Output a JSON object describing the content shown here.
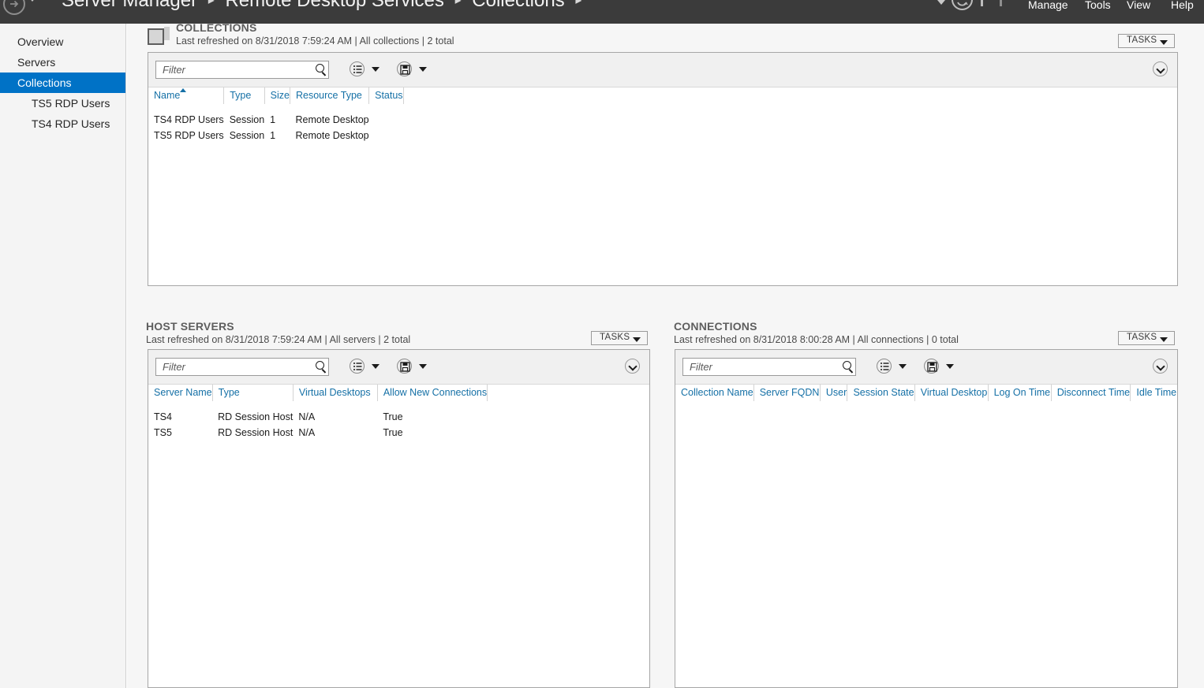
{
  "header": {
    "back_icon": "back-arrow-icon",
    "caret_icon": "chevron-down-icon",
    "breadcrumb": [
      "Server Manager",
      "Remote Desktop Services",
      "Collections"
    ],
    "separator": "▸",
    "refresh_icon": "refresh-icon",
    "notifications_icon": "flag-icon",
    "menus": [
      "Manage",
      "Tools",
      "View",
      "Help"
    ]
  },
  "sidebar": {
    "items": [
      {
        "label": "Overview",
        "selected": false,
        "sub": false
      },
      {
        "label": "Servers",
        "selected": false,
        "sub": false
      },
      {
        "label": "Collections",
        "selected": true,
        "sub": false
      },
      {
        "label": "TS5 RDP Users",
        "selected": false,
        "sub": true
      },
      {
        "label": "TS4 RDP Users",
        "selected": false,
        "sub": true
      }
    ],
    "selected_color": "#0072c6"
  },
  "collections_panel": {
    "icon": "monitor-icon",
    "title": "COLLECTIONS",
    "subtitle": "Last refreshed on 8/31/2018 7:59:24 AM | All collections  | 2 total",
    "tasks_label": "TASKS",
    "filter_placeholder": "Filter",
    "filter_value": "",
    "search_icon": "search-icon",
    "list-view_icon": "list-options-icon",
    "save_icon": "save-icon",
    "collapse_icon": "chevron-down-circle-icon",
    "columns": [
      "Name",
      "Type",
      "Size",
      "Resource Type",
      "Status"
    ],
    "sorted_column": "Name",
    "sort_direction": "asc",
    "rows": [
      {
        "name": "TS4 RDP Users",
        "type": "Session",
        "size": "1",
        "resource_type": "Remote Desktop",
        "status": ""
      },
      {
        "name": "TS5 RDP Users",
        "type": "Session",
        "size": "1",
        "resource_type": "Remote Desktop",
        "status": ""
      }
    ]
  },
  "host_servers_panel": {
    "title": "HOST SERVERS",
    "subtitle": "Last refreshed on 8/31/2018 7:59:24 AM | All servers  | 2 total",
    "tasks_label": "TASKS",
    "filter_placeholder": "Filter",
    "filter_value": "",
    "columns": [
      "Server Name",
      "Type",
      "Virtual Desktops",
      "Allow New Connections"
    ],
    "rows": [
      {
        "server_name": "TS4",
        "type": "RD Session Host",
        "virtual_desktops": "N/A",
        "allow_new_connections": "True"
      },
      {
        "server_name": "TS5",
        "type": "RD Session Host",
        "virtual_desktops": "N/A",
        "allow_new_connections": "True"
      }
    ]
  },
  "connections_panel": {
    "title": "CONNECTIONS",
    "subtitle": "Last refreshed on 8/31/2018 8:00:28 AM | All connections  | 0 total",
    "tasks_label": "TASKS",
    "filter_placeholder": "Filter",
    "filter_value": "",
    "columns": [
      "Collection Name",
      "Server FQDN",
      "User",
      "Session State",
      "Virtual Desktop",
      "Log On Time",
      "Disconnect Time",
      "Idle Time"
    ],
    "rows": []
  },
  "colors": {
    "header_bg": "#3b3b3b",
    "accent": "#0072c6",
    "link": "#1570a6",
    "panel_bg": "#f6f6f6"
  }
}
